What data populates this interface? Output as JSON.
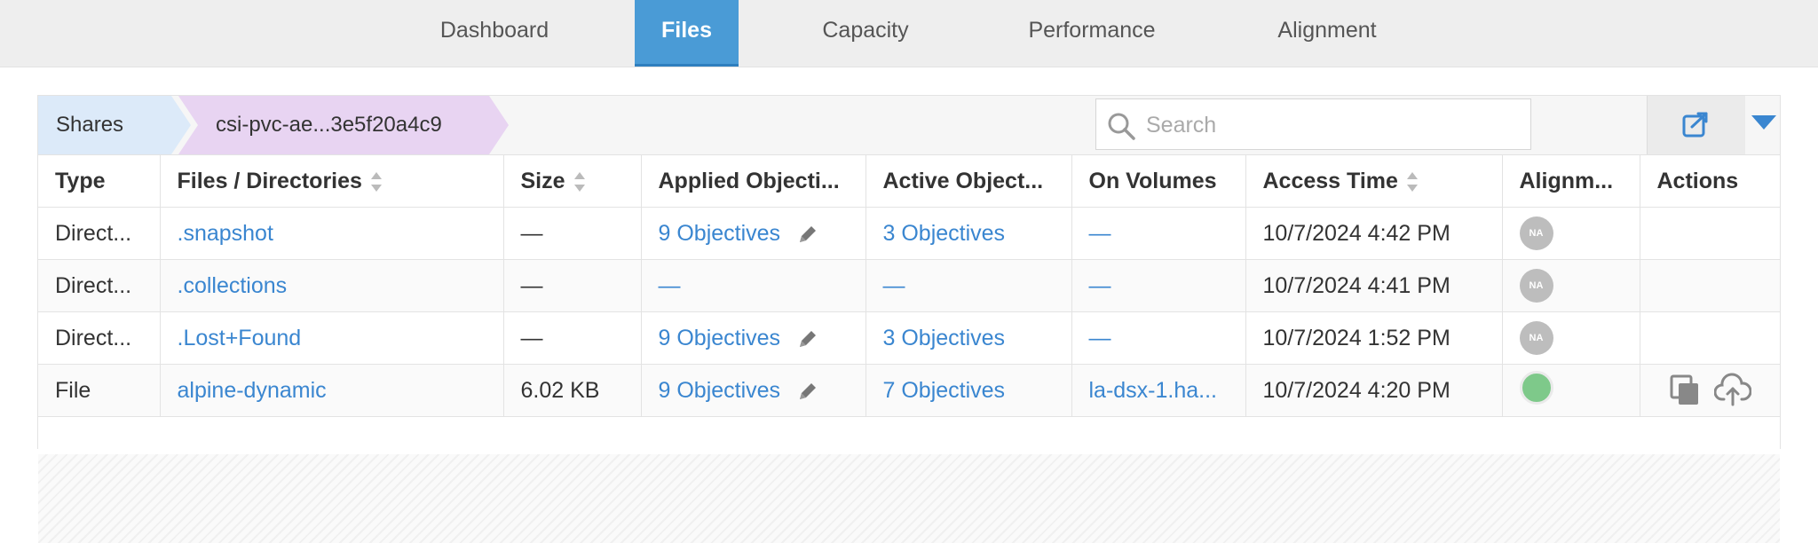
{
  "tabs": [
    "Dashboard",
    "Files",
    "Capacity",
    "Performance",
    "Alignment"
  ],
  "active_tab": "Files",
  "breadcrumb": {
    "root": "Shares",
    "current": "csi-pvc-ae...3e5f20a4c9"
  },
  "search": {
    "placeholder": "Search",
    "value": ""
  },
  "table": {
    "columns": [
      "Type",
      "Files / Directories",
      "Size",
      "Applied Objecti...",
      "Active Object...",
      "On Volumes",
      "Access Time",
      "Alignm...",
      "Actions"
    ],
    "rows": [
      {
        "type": "Direct...",
        "name": ".snapshot",
        "size": "—",
        "applied": "9 Objectives",
        "active": "3 Objectives",
        "volumes": "—",
        "access_time": "10/7/2024 4:42 PM",
        "alignment": "NA"
      },
      {
        "type": "Direct...",
        "name": ".collections",
        "size": "—",
        "applied": "—",
        "active": "—",
        "volumes": "—",
        "access_time": "10/7/2024 4:41 PM",
        "alignment": "NA"
      },
      {
        "type": "Direct...",
        "name": ".Lost+Found",
        "size": "—",
        "applied": "9 Objectives",
        "active": "3 Objectives",
        "volumes": "—",
        "access_time": "10/7/2024 1:52 PM",
        "alignment": "NA"
      },
      {
        "type": "File",
        "name": "alpine-dynamic",
        "size": "6.02 KB",
        "applied": "9 Objectives",
        "active": "7 Objectives",
        "volumes": "la-dsx-1.ha...",
        "access_time": "10/7/2024 4:20 PM",
        "alignment": "ok"
      }
    ]
  },
  "colors": {
    "accent": "#4a9bd6",
    "link": "#3a86d0",
    "aligned": "#7ec98a",
    "na": "#bdbdbd"
  },
  "icons": [
    "search-icon",
    "export-icon",
    "dropdown-icon",
    "sort-icon",
    "pencil-icon",
    "copy-icon",
    "upload-icon"
  ]
}
